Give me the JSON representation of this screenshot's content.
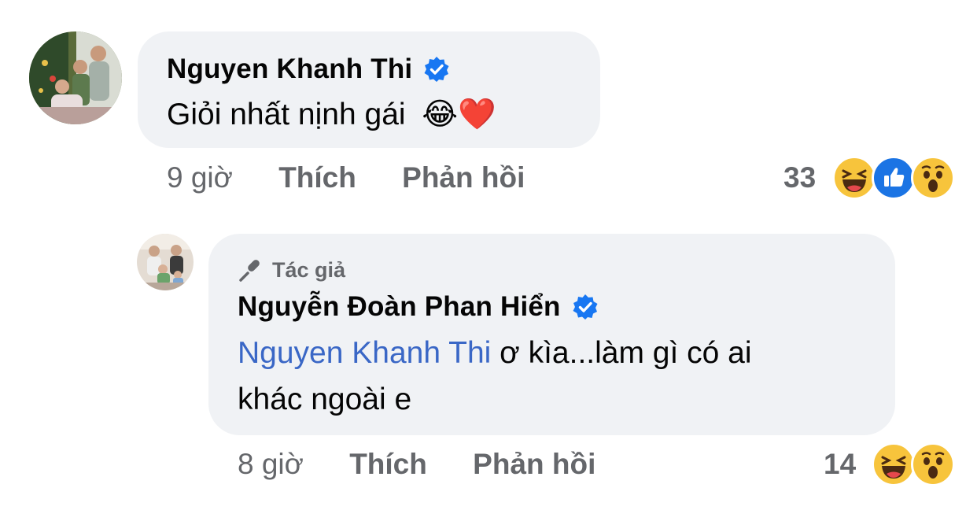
{
  "comment": {
    "author": "Nguyen Khanh Thi",
    "text": "Giỏi nhất nịnh gái",
    "emoji": "😂❤️",
    "time": "9 giờ",
    "like_label": "Thích",
    "reply_label": "Phản hồi",
    "reaction_count": "33",
    "reactions": [
      "laugh",
      "like",
      "wow"
    ]
  },
  "reply": {
    "badge": "Tác giả",
    "author": "Nguyễn Đoàn Phan Hiển",
    "mention": "Nguyen Khanh Thi",
    "text_line1": " ơ kìa...làm gì có ai",
    "text_line2": "khác ngoài e",
    "time": "8 giờ",
    "like_label": "Thích",
    "reply_label": "Phản hồi",
    "reaction_count": "14",
    "reactions": [
      "laugh",
      "wow"
    ]
  },
  "colors": {
    "bubble": "#f0f2f5",
    "verified": "#1877f2",
    "mention": "#3a67c6",
    "meta": "#65676b"
  }
}
